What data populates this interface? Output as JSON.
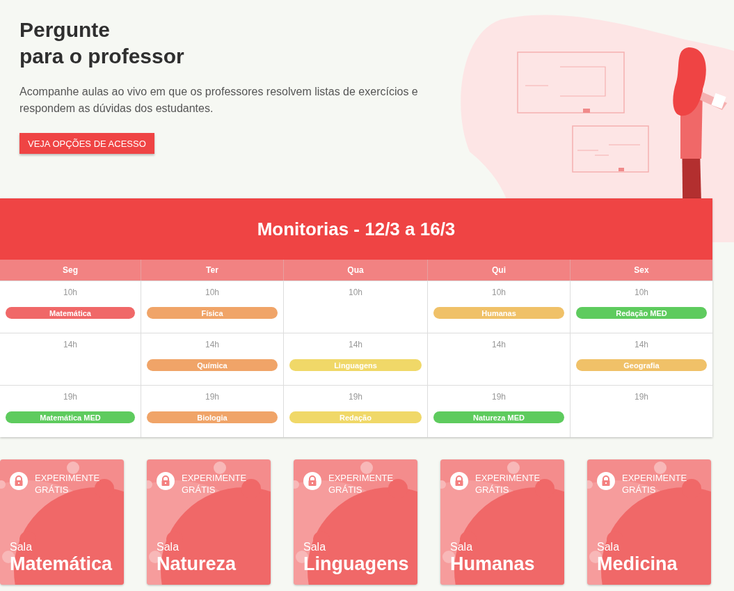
{
  "hero": {
    "title_lines": [
      "Pergunte",
      "para o professor"
    ],
    "description": "Acompanhe aulas ao vivo em que os professores resolvem listas de exercícios e respondem as dúvidas dos estudantes.",
    "button": "VEJA OPÇÕES DE ACESSO"
  },
  "schedule": {
    "title": "Monitorias - 12/3 a 16/3",
    "days": [
      "Seg",
      "Ter",
      "Qua",
      "Qui",
      "Sex"
    ],
    "rows": [
      {
        "cells": [
          {
            "time": "10h",
            "event": {
              "label": "Matemática",
              "color": "#f06868"
            }
          },
          {
            "time": "10h",
            "event": {
              "label": "Física",
              "color": "#f0a468"
            }
          },
          {
            "time": "10h"
          },
          {
            "time": "10h",
            "event": {
              "label": "Humanas",
              "color": "#f0c168"
            }
          },
          {
            "time": "10h",
            "event": {
              "label": "Redação MED",
              "color": "#5ecb5e"
            }
          }
        ]
      },
      {
        "cells": [
          {
            "time": "14h"
          },
          {
            "time": "14h",
            "event": {
              "label": "Química",
              "color": "#f0a468"
            }
          },
          {
            "time": "14h",
            "event": {
              "label": "Linguagens",
              "color": "#f0d868"
            }
          },
          {
            "time": "14h"
          },
          {
            "time": "14h",
            "event": {
              "label": "Geografia",
              "color": "#f0c168"
            }
          }
        ]
      },
      {
        "cells": [
          {
            "time": "19h",
            "event": {
              "label": "Matemática MED",
              "color": "#5ecb5e"
            }
          },
          {
            "time": "19h",
            "event": {
              "label": "Biologia",
              "color": "#f0a468"
            }
          },
          {
            "time": "19h",
            "event": {
              "label": "Redação",
              "color": "#f0d868"
            }
          },
          {
            "time": "19h",
            "event": {
              "label": "Natureza MED",
              "color": "#5ecb5e"
            }
          },
          {
            "time": "19h"
          }
        ]
      }
    ]
  },
  "rooms": [
    {
      "badge": "EXPERIMENTE GRÁTIS",
      "prefix": "Sala",
      "name": "Matemática"
    },
    {
      "badge": "EXPERIMENTE GRÁTIS",
      "prefix": "Sala",
      "name": "Natureza"
    },
    {
      "badge": "EXPERIMENTE GRÁTIS",
      "prefix": "Sala",
      "name": "Linguagens"
    },
    {
      "badge": "EXPERIMENTE GRÁTIS",
      "prefix": "Sala",
      "name": "Humanas"
    },
    {
      "badge": "EXPERIMENTE GRÁTIS",
      "prefix": "Sala",
      "name": "Medicina"
    }
  ]
}
